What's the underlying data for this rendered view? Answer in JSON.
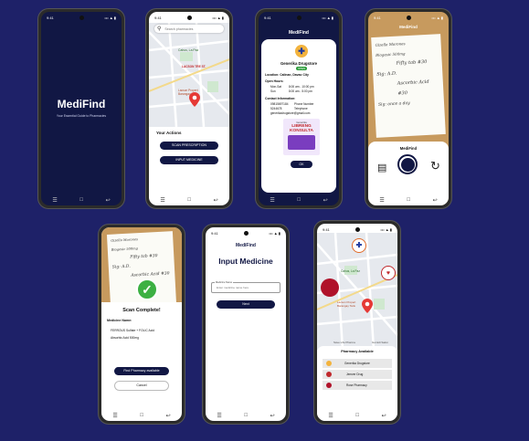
{
  "app": {
    "status_time": "9:41",
    "signal": "••• ▲ ▮"
  },
  "splash": {
    "title": "MediFind",
    "tagline": "Your Essential Guide to Pharmacies"
  },
  "search": {
    "placeholder": "Search pharmacies",
    "map_labels": [
      "Cahus, La Paz",
      "LACSON TRE ST."
    ],
    "map_place": "Lacson Propert Barangay Tank",
    "actions_title": "Your Actions",
    "scan_button": "SCAN PRESCRIPTION",
    "input_button": "INPUT MEDICINE"
  },
  "pharmacy_detail": {
    "header_title": "MediFind",
    "name": "Generika Drugstore",
    "status": "OPEN",
    "location": "Location: Calinan, Davao City",
    "hours_title": "Open Hours:",
    "hours": [
      {
        "days": "Mon-Sat",
        "time": "8:00 am - 10:00 pm"
      },
      {
        "days": "Sun",
        "time": "8:00 am - 5:00 pm"
      }
    ],
    "contact_title": "Contact Information:",
    "contacts": [
      {
        "value": "09815697184",
        "type": "Phone Number"
      },
      {
        "value": "5244678",
        "type": "Telephone"
      },
      {
        "value": "generikadrugstore@gmail.com",
        "type": ""
      }
    ],
    "ad_small": "Generika",
    "ad_title": "LIBRENG KONSULTA",
    "ok_button": "OK"
  },
  "scan_camera": {
    "header_title": "MediFind",
    "note_lines": [
      "Gizella Morones",
      "Biogesic 500mg",
      "Fifty tab #30",
      "Sig: A.D.",
      "Ascorbic Acid #30",
      "Sig: once a day"
    ],
    "panel_title": "MediFind"
  },
  "scan_complete": {
    "title": "Scan Complete!",
    "medicine_label": "Medicine Name:",
    "medicines": [
      "FERROUS Sulfate + FOLIC Acid",
      "Absorbic Acid 500mg"
    ],
    "find_button": "Find Pharmacy available",
    "cancel_button": "Cancel"
  },
  "input_medicine": {
    "status_time": "9:41",
    "header_title": "MediFind",
    "title": "Input Medicine",
    "field_label": "Medicine Name",
    "field_placeholder": "Enter medicine name here",
    "submit_button": "Next"
  },
  "pharmacy_list": {
    "map_labels": [
      "Cahus, La Paz",
      "Lacson Propert Barangay Tank",
      "Save Life Pharma",
      "Gomidi Salon"
    ],
    "title": "Pharmacy Available",
    "items": [
      {
        "name": "Generika Drugstore",
        "color": "#e06b2a"
      },
      {
        "name": "Jemver Drug",
        "color": "#c0282c"
      },
      {
        "name": "Rose Pharmacy",
        "color": "#b0122a"
      }
    ]
  },
  "colors": {
    "background": "#1e2168",
    "navy": "#111744",
    "pin": "#e53935"
  }
}
